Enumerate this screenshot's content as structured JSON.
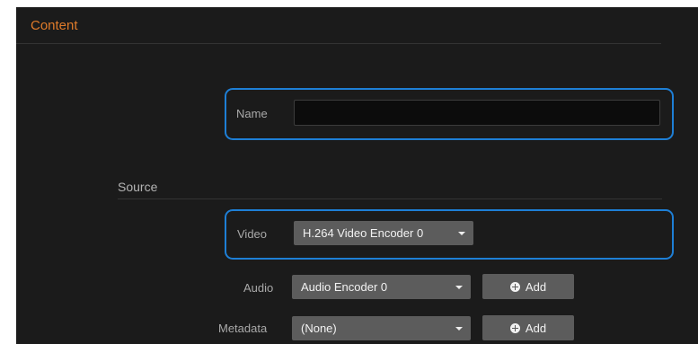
{
  "content": {
    "title": "Content",
    "name_label": "Name",
    "name_value": ""
  },
  "source": {
    "title": "Source",
    "video_label": "Video",
    "video_selected": "H.264 Video Encoder 0",
    "audio_label": "Audio",
    "audio_selected": "Audio Encoder 0",
    "audio_add_label": "Add",
    "metadata_label": "Metadata",
    "metadata_selected": "(None)",
    "metadata_add_label": "Add"
  },
  "colors": {
    "panel_bg": "#1b1b1b",
    "section_title": "#e07b2a",
    "highlight": "#1e7fd6",
    "control_bg": "#5c5c5c"
  },
  "icons": {
    "dropdown": "caret-down-icon",
    "add": "plus-circle-icon"
  }
}
